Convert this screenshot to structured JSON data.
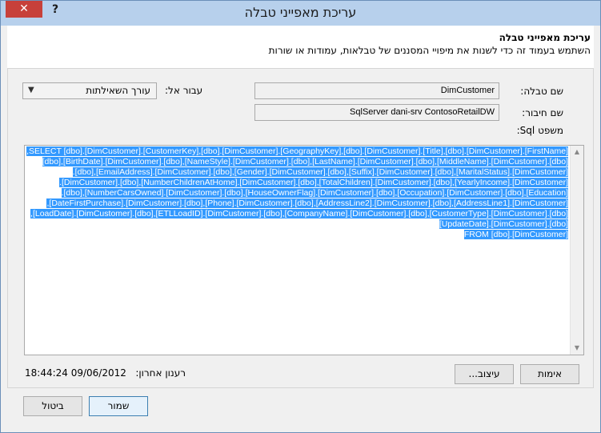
{
  "window": {
    "title": "עריכת מאפייני טבלה",
    "close_glyph": "✕",
    "help_glyph": "?"
  },
  "header": {
    "title": "עריכת מאפייני טבלה",
    "description": "השתמש בעמוד זה כדי לשנות את מיפויי המסננים של טבלאות, עמודות או שורות"
  },
  "form": {
    "table_name_label": "שם טבלה:",
    "table_name_value": "DimCustomer",
    "connection_label": "שם חיבור:",
    "connection_value": "SqlServer dani-srv ContosoRetailDW",
    "switch_label": "עבור אל:",
    "switch_value": "עורך השאילתות",
    "sql_label": "משפט Sql:"
  },
  "sql": {
    "lines": [
      "SELECT [dbo].[DimCustomer].[CustomerKey],[dbo].[DimCustomer].[GeographyKey],[dbo].[DimCustomer].[Title],[dbo].[DimCustomer].[FirstName],",
      "[dbo].[DimCustomer].[MiddleName],[dbo].[DimCustomer].[LastName],[dbo].[DimCustomer].[NameStyle],[dbo].[DimCustomer].[BirthDate],[dbo]",
      "[DimCustomer].[MaritalStatus],[dbo].[DimCustomer].[Suffix],[dbo].[DimCustomer].[Gender],[dbo].[DimCustomer].[EmailAddress],[dbo].",
      "[DimCustomer].[YearlyIncome],[dbo].[DimCustomer].[TotalChildren],[dbo].[DimCustomer].[NumberChildrenAtHome],[dbo].[DimCustomer].",
      "[Education],[dbo].[DimCustomer].[Occupation],[dbo].[DimCustomer].[HouseOwnerFlag],[dbo].[DimCustomer].[NumberCarsOwned],[dbo].",
      "[DimCustomer].[AddressLine1],[dbo].[DimCustomer].[AddressLine2],[dbo].[DimCustomer].[Phone],[dbo].[DimCustomer].[DateFirstPurchase],",
      "[dbo].[DimCustomer].[CustomerType],[dbo].[DimCustomer].[CompanyName],[dbo].[DimCustomer].[ETLLoadID],[dbo].[DimCustomer].[LoadDate],",
      "[dbo].[DimCustomer].[UpdateDate]",
      "FROM [dbo].[DimCustomer]"
    ]
  },
  "status": {
    "refresh_label": "רענון אחרון:",
    "refresh_value": "18:44:24 09/06/2012"
  },
  "buttons": {
    "validate": "אימות",
    "design": "עיצוב...",
    "save": "שמור",
    "cancel": "ביטול"
  },
  "colors": {
    "titlebar": "#b7d0ec",
    "close": "#c7403a",
    "selection": "#3399ff"
  }
}
